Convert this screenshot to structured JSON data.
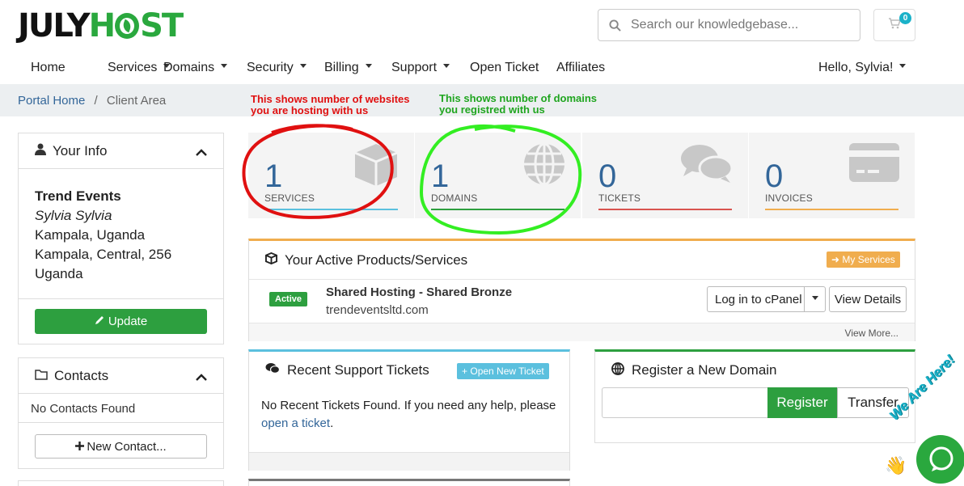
{
  "logo": {
    "part1": "JULY",
    "part2_pre": "H",
    "part2_post": "ST"
  },
  "search": {
    "placeholder": "Search our knowledgebase..."
  },
  "cart": {
    "count": "0"
  },
  "nav": {
    "items": [
      "Home",
      "Services",
      "Domains",
      "Security",
      "Billing",
      "Support",
      "Open Ticket",
      "Affiliates"
    ],
    "user": "Hello, Sylvia!"
  },
  "breadcrumb": {
    "home": "Portal Home",
    "sep": "/",
    "current": "Client Area"
  },
  "annotations": {
    "websites": [
      "This shows number of websites",
      "you are hosting with us"
    ],
    "domains": [
      "This shows number of domains",
      "you registred with us"
    ]
  },
  "your_info": {
    "title": "Your Info",
    "company": "Trend Events",
    "name": "Sylvia Sylvia",
    "line1": "Kampala, Uganda",
    "line2": "Kampala, Central, 256",
    "line3": "Uganda",
    "update": "Update"
  },
  "contacts": {
    "title": "Contacts",
    "empty": "No Contacts Found",
    "new": "New Contact..."
  },
  "stats": [
    {
      "value": "1",
      "label": "SERVICES",
      "color": "#5bc0de"
    },
    {
      "value": "1",
      "label": "DOMAINS",
      "color": "#2d9f3f"
    },
    {
      "value": "0",
      "label": "TICKETS",
      "color": "#d9534f"
    },
    {
      "value": "0",
      "label": "INVOICES",
      "color": "#f0ad4e"
    }
  ],
  "products": {
    "title": "Your Active Products/Services",
    "my_services": "My Services",
    "status": "Active",
    "product": "Shared Hosting - Shared Bronze",
    "domain": "trendeventsltd.com",
    "cpanel": "Log in to cPanel",
    "details": "View Details",
    "more": "View More..."
  },
  "tickets": {
    "title": "Recent Support Tickets",
    "open_new": "Open New Ticket",
    "text": "No Recent Tickets Found. If you need any help, please",
    "link": "open a ticket",
    "after": "."
  },
  "register": {
    "title": "Register a New Domain",
    "register": "Register",
    "transfer": "Transfer"
  },
  "chat": {
    "label": "We Are Here!"
  },
  "colors": {
    "accent": "#2aa83e",
    "link": "#336699",
    "orange": "#f0ad4e",
    "teal": "#5bc0de"
  }
}
